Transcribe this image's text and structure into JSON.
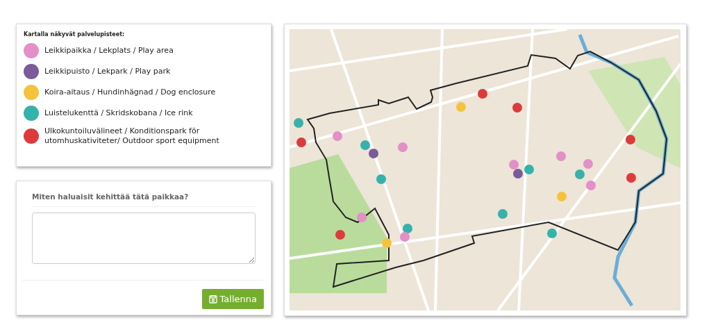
{
  "legend": {
    "title": "Kartalla näkyvät palvelupisteet:",
    "items": [
      {
        "label": "Leikkipaikka / Lekplats / Play area",
        "color": "#e38fc8"
      },
      {
        "label": "Leikkipuisto / Lekpark / Play park",
        "color": "#7b5b9a"
      },
      {
        "label": "Koira-aitaus / Hundinhägnad / Dog enclosure",
        "color": "#f5c33b"
      },
      {
        "label": "Luistelukenttä / Skridskobana / Ice rink",
        "color": "#35b2ab"
      },
      {
        "label": "Ulkokuntoiluvälineet / Konditionspark för utomhuskativiteter/ Outdoor sport equipment",
        "color": "#dd3b3b"
      }
    ]
  },
  "form": {
    "question": "Miten haluaisit kehittää tätä paikkaa?",
    "save_button": "Tallenna"
  }
}
